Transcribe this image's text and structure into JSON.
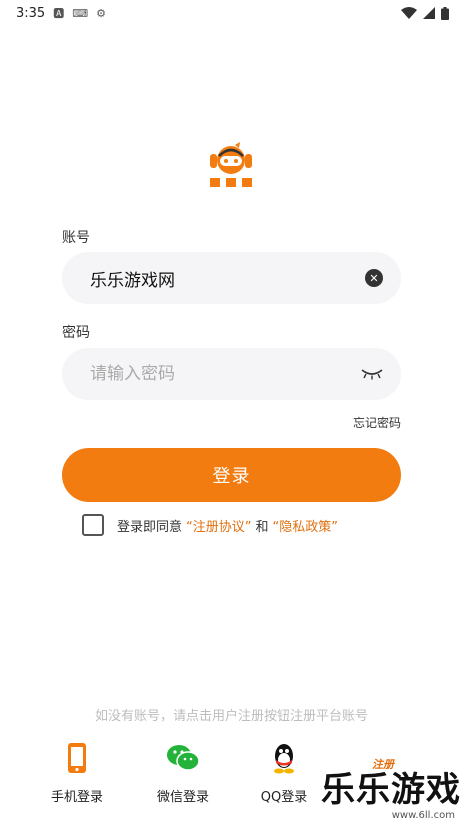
{
  "status_bar": {
    "time": "3:35"
  },
  "colors": {
    "accent": "#f27c10",
    "field_bg": "#f5f5f7"
  },
  "account": {
    "label": "账号",
    "value": "乐乐游戏网"
  },
  "password": {
    "label": "密码",
    "placeholder": "请输入密码"
  },
  "forgot_label": "忘记密码",
  "login_label": "登录",
  "agreement": {
    "prefix": "登录即同意",
    "terms": "“注册协议”",
    "and": "和",
    "privacy": "“隐私政策”"
  },
  "hint": "如没有账号，请点击用户注册按钮注册平台账号",
  "nav": {
    "phone": "手机登录",
    "wechat": "微信登录",
    "qq": "QQ登录",
    "register": "注册"
  },
  "watermark": {
    "text": "乐乐游戏",
    "url": "www.6ll.com"
  }
}
